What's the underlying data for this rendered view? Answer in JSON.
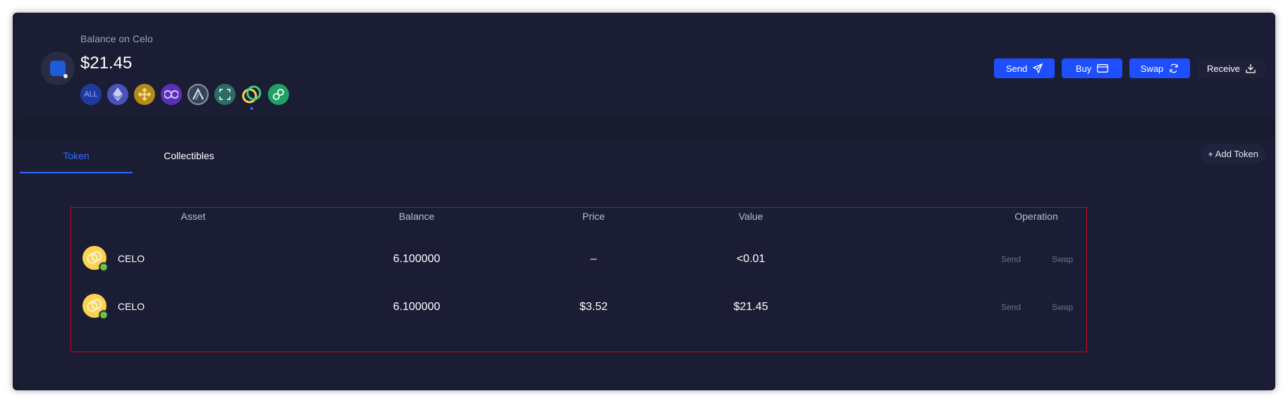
{
  "header": {
    "balance_label": "Balance on Celo",
    "balance_value": "$21.45",
    "chains": [
      {
        "label": "ALL",
        "icon": "all-chains-icon",
        "color": "#1f3a9e"
      },
      {
        "label": "",
        "icon": "ethereum-icon",
        "color": "#4753b8"
      },
      {
        "label": "",
        "icon": "bnb-icon",
        "color": "#b58a1a"
      },
      {
        "label": "",
        "icon": "polygon-icon",
        "color": "#5b2fb8"
      },
      {
        "label": "",
        "icon": "arbitrum-icon",
        "color": "#3c4256"
      },
      {
        "label": "",
        "icon": "blocks-icon",
        "color": "#2f6b66"
      },
      {
        "label": "",
        "icon": "celo-icon",
        "color": "#fcd34d",
        "active": true
      },
      {
        "label": "",
        "icon": "link-chain-icon",
        "color": "#21a063"
      }
    ],
    "actions": {
      "send": "Send",
      "buy": "Buy",
      "swap": "Swap",
      "receive": "Receive"
    }
  },
  "tabs": {
    "token": "Token",
    "collectibles": "Collectibles"
  },
  "add_token": "+ Add Token",
  "table": {
    "columns": {
      "asset": "Asset",
      "balance": "Balance",
      "price": "Price",
      "value": "Value",
      "operation": "Operation"
    },
    "rows": [
      {
        "asset": "CELO",
        "balance": "6.100000",
        "price": "–",
        "value": "<0.01",
        "send": "Send",
        "swap": "Swap"
      },
      {
        "asset": "CELO",
        "balance": "6.100000",
        "price": "$3.52",
        "value": "$21.45",
        "send": "Send",
        "swap": "Swap"
      }
    ]
  },
  "colors": {
    "accent": "#1d4fff",
    "background": "#1a1c33",
    "highlight_border": "#d0021b",
    "celo": "#fcd34d"
  }
}
